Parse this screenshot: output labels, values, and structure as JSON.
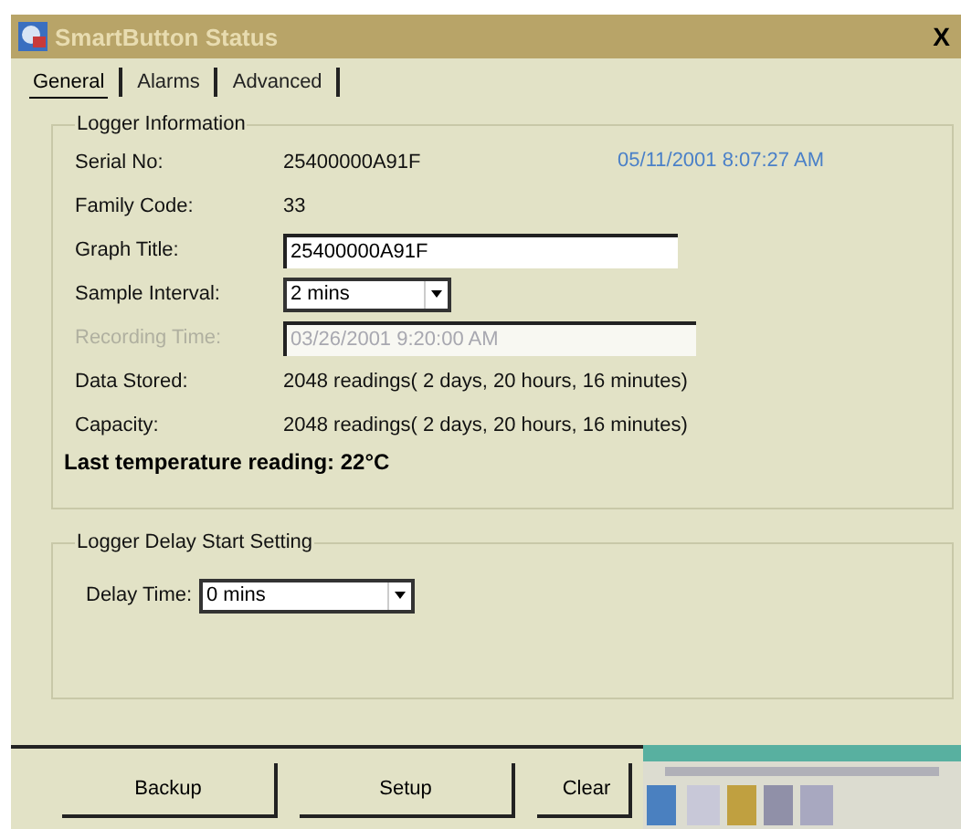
{
  "window": {
    "title": "SmartButton Status",
    "close": "X"
  },
  "tabs": [
    {
      "label": "General",
      "selected": true
    },
    {
      "label": "Alarms",
      "selected": false
    },
    {
      "label": "Advanced",
      "selected": false
    }
  ],
  "logger_information": {
    "title": "Logger Information",
    "timestamp": "05/11/2001 8:07:27 AM",
    "fields": [
      {
        "kind": "text",
        "label": "Serial No:",
        "value": "25400000A91F",
        "disabled": false
      },
      {
        "kind": "text",
        "label": "Family Code:",
        "value": "33",
        "disabled": false
      },
      {
        "kind": "input",
        "label": "Graph Title:",
        "value": "25400000A91F",
        "disabled": false
      },
      {
        "kind": "select",
        "label": "Sample Interval:",
        "value": "2 mins",
        "disabled": false
      },
      {
        "kind": "input",
        "label": "Recording Time:",
        "value": "03/26/2001 9:20:00 AM",
        "disabled": true
      },
      {
        "kind": "text",
        "label": "Data Stored:",
        "value": "2048 readings( 2 days, 20 hours, 16 minutes)",
        "disabled": false
      },
      {
        "kind": "text",
        "label": "Capacity:",
        "value": "2048 readings( 2 days, 20 hours, 16 minutes)",
        "disabled": false
      }
    ],
    "last_reading": "Last temperature reading: 22°C"
  },
  "delay_start": {
    "title": "Logger Delay Start Setting",
    "label": "Delay Time:",
    "value": "0 mins"
  },
  "buttons": [
    "Backup",
    "Setup",
    "Clear"
  ]
}
